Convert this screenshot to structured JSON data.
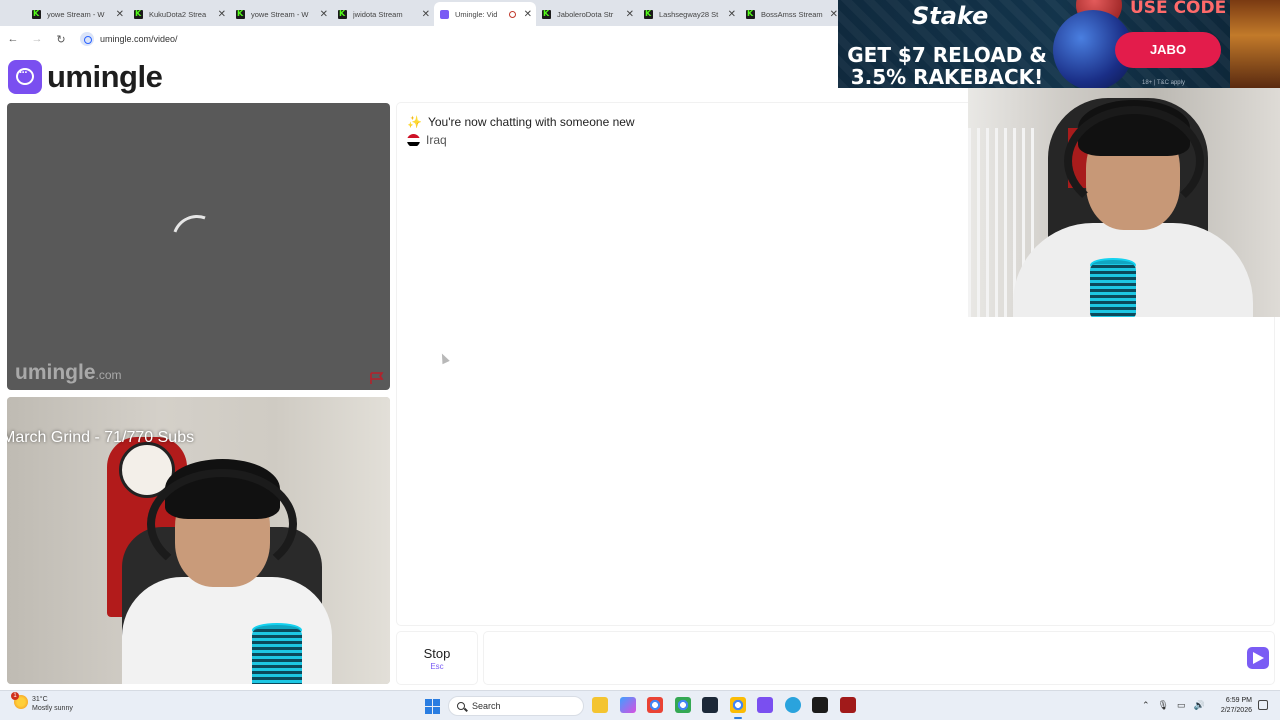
{
  "browser": {
    "tabs": [
      {
        "title": "yowe Stream - W",
        "icon": "kick-icon",
        "active": false
      },
      {
        "title": "KukuDota2 Strea",
        "icon": "kick-icon",
        "active": false
      },
      {
        "title": "yowe Stream - W",
        "icon": "kick-icon",
        "active": false
      },
      {
        "title": "jwidota Stream",
        "icon": "kick-icon",
        "active": false
      },
      {
        "title": "Umingle: Vid",
        "icon": "umingle-icon",
        "active": true
      },
      {
        "title": "JaboleroDota Str",
        "icon": "kick-icon",
        "active": false
      },
      {
        "title": "Lashsegway28 St",
        "icon": "kick-icon",
        "active": false
      },
      {
        "title": "BossAmss Stream",
        "icon": "kick-icon",
        "active": false
      }
    ],
    "url": "umingle.com/video/"
  },
  "site": {
    "logo_text": "umingle",
    "brand_color": "#7a4ff0"
  },
  "video": {
    "watermark": "umingle",
    "watermark_suffix": ".com",
    "overlay_text": "March Grind - 71/770 Subs"
  },
  "chat": {
    "system_message": "You're now chatting with someone new",
    "country": "Iraq",
    "stop_label": "Stop",
    "stop_shortcut": "Esc",
    "input_placeholder": ""
  },
  "ad": {
    "brand": "Stake",
    "headline": "GET $7 RELOAD & 3.5% RAKEBACK!",
    "use_code_label": "USE CODE",
    "code": "JABO",
    "terms": "18+ | T&C apply"
  },
  "taskbar": {
    "temperature": "31°C",
    "condition": "Mostly sunny",
    "search_label": "Search",
    "time": "6:59 PM",
    "date": "2/27/2026",
    "weather_badge": "1"
  }
}
